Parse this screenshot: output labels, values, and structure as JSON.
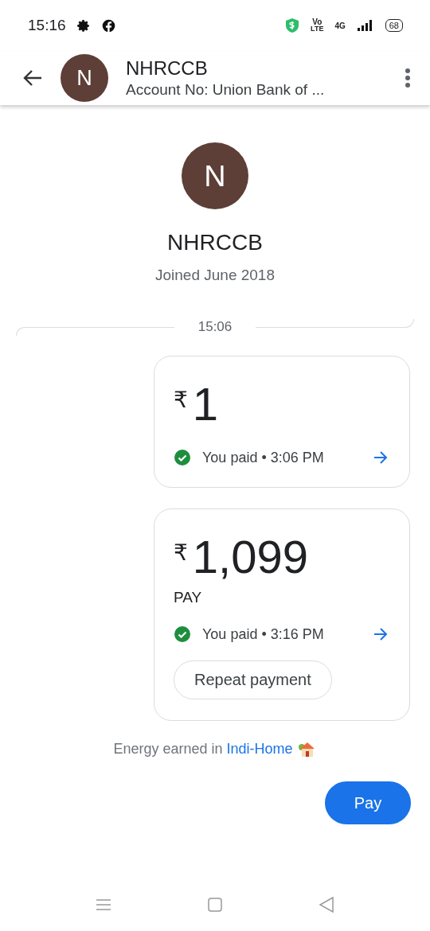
{
  "status_bar": {
    "time": "15:16",
    "volte_top": "Vo",
    "volte_bottom": "LTE",
    "network": "4G",
    "battery": "68"
  },
  "header": {
    "initial": "N",
    "title": "NHRCCB",
    "subtitle": "Account No: Union Bank of ..."
  },
  "profile": {
    "initial": "N",
    "name": "NHRCCB",
    "joined": "Joined June 2018"
  },
  "divider_time": "15:06",
  "payments": [
    {
      "currency": "₹",
      "amount": "1",
      "completed": true,
      "status": "You paid • 3:06 PM"
    },
    {
      "currency": "₹",
      "amount": "1,099",
      "note": "PAY",
      "completed": true,
      "status": "You paid • 3:16 PM",
      "action": "Repeat payment"
    }
  ],
  "footer": {
    "prefix": "Energy earned in",
    "link": "Indi-Home"
  },
  "pay_button": "Pay"
}
